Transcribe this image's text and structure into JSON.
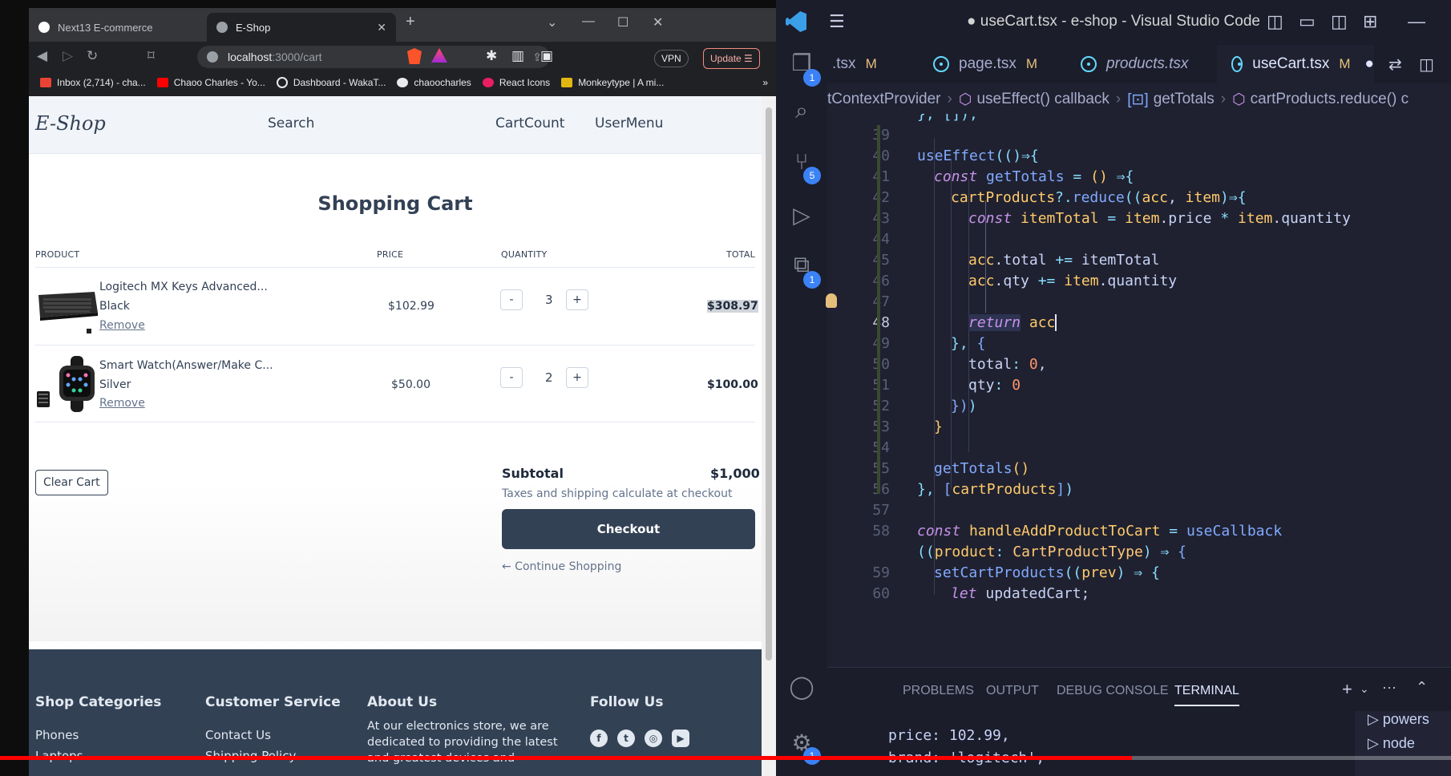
{
  "browser": {
    "tabs": [
      {
        "title": "Next13 E-commerce",
        "active": false
      },
      {
        "title": "E-Shop",
        "active": true
      }
    ],
    "url_host": "localhost",
    "url_path": ":3000/cart",
    "vpn_label": "VPN",
    "update_label": "Update",
    "bookmarks": [
      "Inbox (2,714) - cha...",
      "Chaoo Charles - Yo...",
      "Dashboard - WakaT...",
      "chaoocharles",
      "React Icons",
      "Monkeytype | A mi..."
    ]
  },
  "site": {
    "logo": "E-Shop",
    "nav": {
      "search": "Search",
      "cart_count": "CartCount",
      "user_menu": "UserMenu"
    },
    "title": "Shopping Cart",
    "columns": [
      "PRODUCT",
      "PRICE",
      "QUANTITY",
      "TOTAL"
    ],
    "items": [
      {
        "name": "Logitech MX Keys Advanced...",
        "variant": "Black",
        "remove": "Remove",
        "price": "$102.99",
        "minus": "-",
        "qty": "3",
        "plus": "+",
        "total": "$308.97"
      },
      {
        "name": "Smart Watch(Answer/Make C...",
        "variant": "Silver",
        "remove": "Remove",
        "price": "$50.00",
        "minus": "-",
        "qty": "2",
        "plus": "+",
        "total": "$100.00"
      }
    ],
    "clear_cart": "Clear Cart",
    "subtotal_label": "Subtotal",
    "subtotal_value": "$1,000",
    "taxes_note": "Taxes and shipping calculate at checkout",
    "checkout": "Checkout",
    "continue": "← Continue Shopping",
    "footer": {
      "shop_categories": "Shop Categories",
      "shop_items": [
        "Phones",
        "Laptops"
      ],
      "customer_service": "Customer Service",
      "service_items": [
        "Contact Us",
        "Shipping Policy"
      ],
      "about_us": "About Us",
      "about_text": "At our electronics store, we are dedicated to providing the latest and greatest devices and",
      "follow_us": "Follow Us"
    }
  },
  "vscode": {
    "title": "● useCart.tsx - e-shop - Visual Studio Code",
    "tabs": [
      {
        "name": ".tsx",
        "status": "M"
      },
      {
        "name": "page.tsx",
        "status": "M"
      },
      {
        "name": "products.tsx",
        "status": ""
      },
      {
        "name": "useCart.tsx",
        "status": "M"
      }
    ],
    "breadcrumb": [
      "tContextProvider",
      "useEffect() callback",
      "getTotals",
      "cartProducts.reduce() c"
    ],
    "badges": {
      "explorer": "1",
      "scm": "5",
      "extensions": "1",
      "settings": "1"
    },
    "lines": [
      "39",
      "40",
      "41",
      "42",
      "43",
      "44",
      "45",
      "46",
      "47",
      "48",
      "49",
      "50",
      "51",
      "52",
      "53",
      "54",
      "55",
      "56",
      "57",
      "58",
      "59",
      "60"
    ],
    "panel_tabs": [
      "PROBLEMS",
      "OUTPUT",
      "DEBUG CONSOLE",
      "TERMINAL"
    ],
    "terminal": [
      "price: 102.99,",
      "brand: 'logitech',"
    ],
    "terminals": [
      "powers",
      "node"
    ]
  },
  "colors": {
    "accent": "#334155",
    "vscode_bg": "#1f2130",
    "progress": "#ff0000"
  },
  "video_progress": 0.78
}
